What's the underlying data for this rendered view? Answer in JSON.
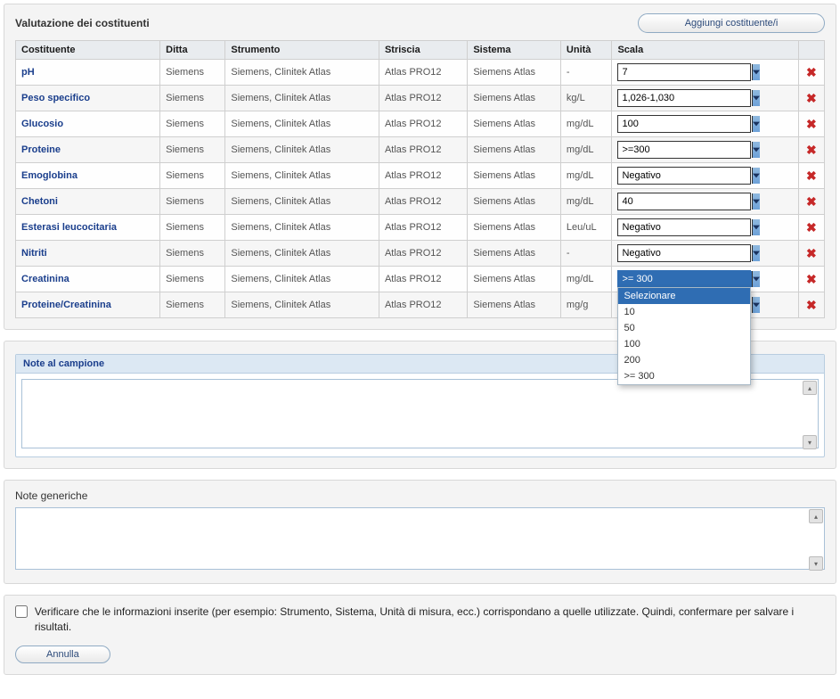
{
  "section_title": "Valutazione dei costituenti",
  "add_button": "Aggiungi costituente/i",
  "headers": {
    "costituente": "Costituente",
    "ditta": "Ditta",
    "strumento": "Strumento",
    "striscia": "Striscia",
    "sistema": "Sistema",
    "unita": "Unità",
    "scala": "Scala"
  },
  "rows": [
    {
      "costituente": "pH",
      "ditta": "Siemens",
      "strumento": "Siemens, Clinitek Atlas",
      "striscia": "Atlas PRO12",
      "sistema": "Siemens Atlas",
      "unita": "-",
      "scala": "7"
    },
    {
      "costituente": "Peso specifico",
      "ditta": "Siemens",
      "strumento": "Siemens, Clinitek Atlas",
      "striscia": "Atlas PRO12",
      "sistema": "Siemens Atlas",
      "unita": "kg/L",
      "scala": "1,026-1,030"
    },
    {
      "costituente": "Glucosio",
      "ditta": "Siemens",
      "strumento": "Siemens, Clinitek Atlas",
      "striscia": "Atlas PRO12",
      "sistema": "Siemens Atlas",
      "unita": "mg/dL",
      "scala": "100"
    },
    {
      "costituente": "Proteine",
      "ditta": "Siemens",
      "strumento": "Siemens, Clinitek Atlas",
      "striscia": "Atlas PRO12",
      "sistema": "Siemens Atlas",
      "unita": "mg/dL",
      "scala": ">=300"
    },
    {
      "costituente": "Emoglobina",
      "ditta": "Siemens",
      "strumento": "Siemens, Clinitek Atlas",
      "striscia": "Atlas PRO12",
      "sistema": "Siemens Atlas",
      "unita": "mg/dL",
      "scala": "Negativo"
    },
    {
      "costituente": "Chetoni",
      "ditta": "Siemens",
      "strumento": "Siemens, Clinitek Atlas",
      "striscia": "Atlas PRO12",
      "sistema": "Siemens Atlas",
      "unita": "mg/dL",
      "scala": "40"
    },
    {
      "costituente": "Esterasi leucocitaria",
      "ditta": "Siemens",
      "strumento": "Siemens, Clinitek Atlas",
      "striscia": "Atlas PRO12",
      "sistema": "Siemens Atlas",
      "unita": "Leu/uL",
      "scala": "Negativo"
    },
    {
      "costituente": "Nitriti",
      "ditta": "Siemens",
      "strumento": "Siemens, Clinitek Atlas",
      "striscia": "Atlas PRO12",
      "sistema": "Siemens Atlas",
      "unita": "-",
      "scala": "Negativo"
    },
    {
      "costituente": "Creatinina",
      "ditta": "Siemens",
      "strumento": "Siemens, Clinitek Atlas",
      "striscia": "Atlas PRO12",
      "sistema": "Siemens Atlas",
      "unita": "mg/dL",
      "scala": ">= 300",
      "open": true
    },
    {
      "costituente": "Proteine/Creatinina",
      "ditta": "Siemens",
      "strumento": "Siemens, Clinitek Atlas",
      "striscia": "Atlas PRO12",
      "sistema": "Siemens Atlas",
      "unita": "mg/g",
      "scala": ""
    }
  ],
  "dropdown_options": [
    "Selezionare",
    "10",
    "50",
    "100",
    "200",
    ">= 300"
  ],
  "note_sample_title": "Note al campione",
  "note_sample_value": "",
  "note_generic_title": "Note generiche",
  "note_generic_value": "",
  "confirm_text": "Verificare che le informazioni inserite (per esempio: Strumento, Sistema, Unità di misura, ecc.) corrispondano a quelle utilizzate. Quindi, confermare per salvare i risultati.",
  "cancel_label": "Annulla"
}
